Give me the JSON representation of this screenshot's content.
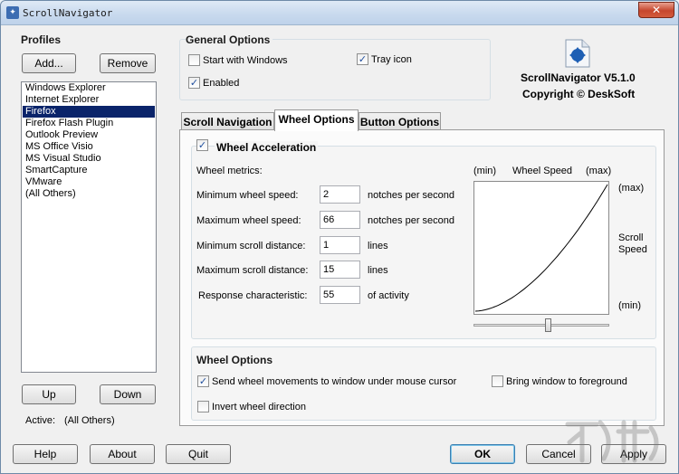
{
  "window": {
    "title": "ScrollNavigator",
    "close_label": "✕"
  },
  "profiles": {
    "title": "Profiles",
    "add_label": "Add...",
    "remove_label": "Remove",
    "items": [
      "Windows Explorer",
      "Internet Explorer",
      "Firefox",
      "Firefox Flash Plugin",
      "Outlook Preview",
      "MS Office Visio",
      "MS Visual Studio",
      "SmartCapture",
      "VMware",
      "(All Others)"
    ],
    "selected_index": 2,
    "up_label": "Up",
    "down_label": "Down",
    "active_label": "Active:",
    "active_value": "(All Others)"
  },
  "general": {
    "title": "General Options",
    "start_with_windows": {
      "label": "Start with Windows",
      "checked": false
    },
    "tray_icon": {
      "label": "Tray icon",
      "checked": true
    },
    "enabled": {
      "label": "Enabled",
      "checked": true
    }
  },
  "about": {
    "product": "ScrollNavigator V5.1.0",
    "copyright": "Copyright © DeskSoft"
  },
  "tabs": [
    "Scroll Navigation",
    "Wheel Options",
    "Button Options"
  ],
  "active_tab": 1,
  "acceleration": {
    "title": "Wheel Acceleration",
    "checked": true,
    "metrics_label": "Wheel metrics:",
    "rows": [
      {
        "label": "Minimum wheel speed:",
        "value": "2",
        "unit": "notches per second"
      },
      {
        "label": "Maximum wheel speed:",
        "value": "66",
        "unit": "notches per second"
      },
      {
        "label": "Minimum scroll distance:",
        "value": "1",
        "unit": "lines"
      },
      {
        "label": "Maximum scroll distance:",
        "value": "15",
        "unit": "lines"
      },
      {
        "label": "Response characteristic:",
        "value": "55",
        "unit": "of activity"
      }
    ],
    "graph": {
      "x_min": "(min)",
      "x_title": "Wheel Speed",
      "x_max": "(max)",
      "y_max": "(max)",
      "y_title_1": "Scroll",
      "y_title_2": "Speed",
      "y_min": "(min)"
    },
    "response_slider": 0.55
  },
  "wheel_options": {
    "title": "Wheel Options",
    "send_to_cursor": {
      "label": "Send wheel movements to window under mouse cursor",
      "checked": true
    },
    "bring_foreground": {
      "label": "Bring window to foreground",
      "checked": false
    },
    "invert": {
      "label": "Invert wheel direction",
      "checked": false
    }
  },
  "footer": {
    "help": "Help",
    "about": "About",
    "quit": "Quit",
    "ok": "OK",
    "cancel": "Cancel",
    "apply": "Apply"
  },
  "colors": {
    "selection": "#0a246a",
    "titlebar": "#c9daee",
    "check": "#1f4e9e"
  }
}
